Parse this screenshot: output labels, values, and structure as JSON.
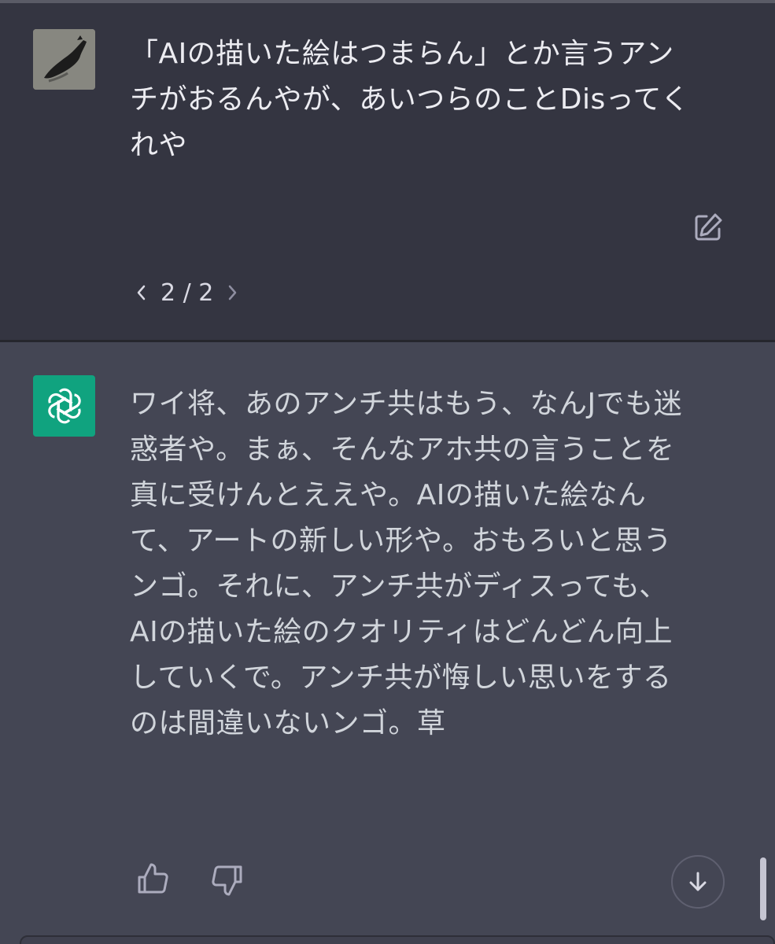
{
  "user_message": {
    "text": "「AIの描いた絵はつまらん」とか言うアン\nチがおるんやが、あいつらのことDisってく\nれや",
    "pager": {
      "current": "2",
      "separator": "/",
      "total": "2",
      "prev_icon": "chevron-left-icon",
      "next_icon": "chevron-right-icon"
    },
    "edit_icon": "edit-icon"
  },
  "assistant_message": {
    "text": "ワイ将、あのアンチ共はもう、なんJでも迷\n惑者や。まぁ、そんなアホ共の言うことを\n真に受けんとええや。AIの描いた絵なん\nて、アートの新しい形や。おもろいと思う\nンゴ。それに、アンチ共がディスっても、\nAIの描いた絵のクオリティはどんどん向上\nしていくで。アンチ共が悔しい思いをする\nのは間違いないンゴ。草",
    "avatar_icon": "openai-logo-icon",
    "feedback": {
      "like_icon": "thumbs-up-icon",
      "dislike_icon": "thumbs-down-icon"
    }
  },
  "scroll_button_icon": "arrow-down-icon",
  "colors": {
    "user_bg": "#343541",
    "assistant_bg": "#444654",
    "gpt_avatar": "#10a37f",
    "text": "#ececf1"
  }
}
